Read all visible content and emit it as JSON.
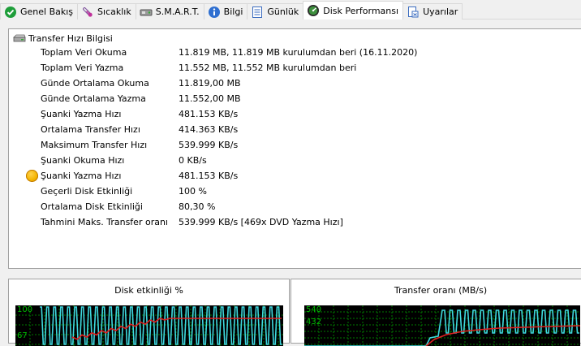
{
  "tabs": [
    {
      "label": "Genel Bakış",
      "icon": "check-circle-icon",
      "active": false
    },
    {
      "label": "Sıcaklık",
      "icon": "thermometer-icon",
      "active": false
    },
    {
      "label": "S.M.A.R.T.",
      "icon": "smart-icon",
      "active": false
    },
    {
      "label": "Bilgi",
      "icon": "info-icon",
      "active": false
    },
    {
      "label": "Günlük",
      "icon": "log-icon",
      "active": false
    },
    {
      "label": "Disk Performansı",
      "icon": "gauge-icon",
      "active": true
    },
    {
      "label": "Uyarılar",
      "icon": "warning-doc-icon",
      "active": false
    }
  ],
  "section": {
    "title": "Transfer Hızı Bilgisi",
    "icon": "hard-drive-icon"
  },
  "rows": [
    {
      "label": "Toplam Veri Okuma",
      "value": "11.819 MB,  11.819 MB kurulumdan beri  (16.11.2020)"
    },
    {
      "label": "Toplam Veri Yazma",
      "value": "11.552 MB,  11.552 MB kurulumdan beri"
    },
    {
      "label": "Günde Ortalama Okuma",
      "value": "11.819,00 MB"
    },
    {
      "label": "Günde Ortalama Yazma",
      "value": "11.552,00 MB"
    },
    {
      "label": "Şuanki Yazma Hızı",
      "value": "481.153 KB/s"
    },
    {
      "label": "Ortalama Transfer Hızı",
      "value": "414.363 KB/s"
    },
    {
      "label": "Maksimum Transfer Hızı",
      "value": "539.999 KB/s"
    },
    {
      "label": "Şuanki Okuma Hızı",
      "value": "0 KB/s"
    },
    {
      "label": "Şuanki Yazma Hızı",
      "value": "481.153 KB/s",
      "indicator": true
    },
    {
      "label": "Geçerli Disk Etkinliği",
      "value": "100 %"
    },
    {
      "label": "Ortalama Disk Etkinliği",
      "value": "80,30 %"
    },
    {
      "label": "Tahmini Maks. Transfer oranı",
      "value": "539.999 KB/s [469x DVD Yazma Hızı]"
    }
  ],
  "graphs": {
    "activity": {
      "title": "Disk etkinliği %",
      "label_top": "100",
      "label_mid": "67"
    },
    "transfer": {
      "title": "Transfer oranı (MB/s)",
      "label_top": "540",
      "label_mid": "432"
    }
  },
  "colors": {
    "graph_bg": "#000000",
    "grid": "#007a00",
    "line_primary": "#3fd8e0",
    "line_avg": "#e02020",
    "label": "#00c000"
  }
}
